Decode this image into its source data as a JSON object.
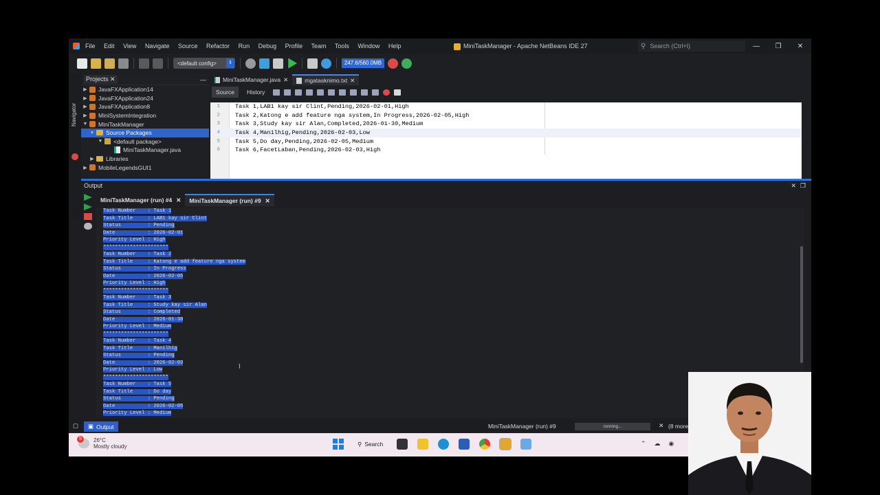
{
  "window": {
    "title": "MiniTaskManager - Apache NetBeans IDE 27",
    "menu": [
      "File",
      "Edit",
      "View",
      "Navigate",
      "Source",
      "Refactor",
      "Run",
      "Debug",
      "Profile",
      "Team",
      "Tools",
      "Window",
      "Help"
    ],
    "search_placeholder": "Search (Ctrl+I)"
  },
  "toolbar": {
    "config": "<default config>",
    "memory": "247.6/560.0MB"
  },
  "navigator_label": "Navigator",
  "projects": {
    "tab_label": "Projects",
    "items": [
      {
        "label": "JavaFXApplication14"
      },
      {
        "label": "JavaFXApplication24"
      },
      {
        "label": "JavaFXApplication8"
      },
      {
        "label": "MiniSystemIntegration"
      },
      {
        "label": "MiniTaskManager"
      },
      {
        "label": "Source Packages"
      },
      {
        "label": "<default package>"
      },
      {
        "label": "MiniTaskManager.java"
      },
      {
        "label": "Libraries"
      },
      {
        "label": "MobileLegendsGUI1"
      }
    ]
  },
  "editor": {
    "tabs": [
      "MiniTaskManager.java",
      "mgatasknimo.txt"
    ],
    "source_btn": "Source",
    "history_btn": "History",
    "lines": [
      {
        "n": "1",
        "text": "Task 1,LAB1 kay sir Clint,Pending,2026-02-01,High"
      },
      {
        "n": "2",
        "text": "Task 2,Katong e add feature nga system,In Progress,2026-02-05,High"
      },
      {
        "n": "3",
        "text": "Task 3,Study kay sir Alan,Completed,2026-01-30,Medium"
      },
      {
        "n": "4",
        "text": "Task 4,Manilhig,Pending,2026-02-03,Low"
      },
      {
        "n": "5",
        "text": "Task 5,Do day,Pending,2026-02-05,Medium"
      },
      {
        "n": "6",
        "text": "Task 6,FacetLaban,Pending,2026-02-03,High"
      }
    ]
  },
  "output": {
    "title": "Output",
    "tabs": [
      "MiniTaskManager (run) #4",
      "MiniTaskManager (run) #9"
    ],
    "lines": [
      "Task Number    : Task 1",
      "Task Title     : LAB1 kay sir Clint",
      "Status         : Pending",
      "Date           : 2026-02-01",
      "Priority Level : High",
      "**********************",
      "Task Number    : Task 2",
      "Task Title     : Katong e add feature nga system",
      "Status         : In Progress",
      "Date           : 2026-02-05",
      "Priority Level : High",
      "**********************",
      "Task Number    : Task 3",
      "Task Title     : Study kay sir Alan",
      "Status         : Completed",
      "Date           : 2026-01-30",
      "Priority Level : Medium",
      "**********************",
      "Task Number    : Task 4",
      "Task Title     : Manilhig",
      "Status         : Pending",
      "Date           : 2026-02-03",
      "Priority Level : Low",
      "**********************",
      "Task Number    : Task 5",
      "Task Title     : Do day",
      "Status         : Pending",
      "Date           : 2026-02-05",
      "Priority Level : Medium"
    ]
  },
  "statusbar": {
    "output_label": "Output",
    "run_label": "MiniTaskManager (run) #9",
    "progress_label": "running...",
    "more_label": "(8 more"
  },
  "taskbar": {
    "weather_badge": "5",
    "temperature": "26°C",
    "condition": "Mostly cloudy",
    "search_label": "Search"
  }
}
